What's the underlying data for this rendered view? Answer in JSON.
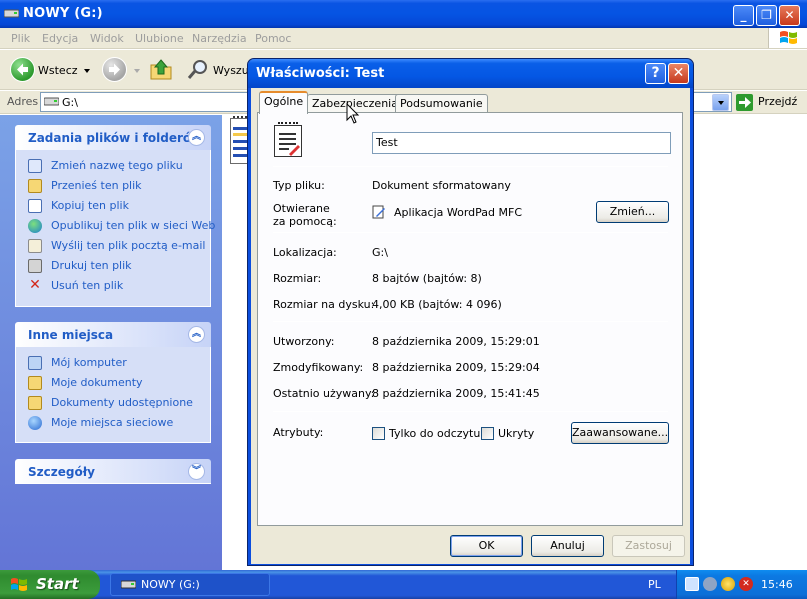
{
  "explorer": {
    "title": "NOWY (G:)",
    "menu": [
      "Plik",
      "Edycja",
      "Widok",
      "Ulubione",
      "Narzędzia",
      "Pomoc"
    ],
    "toolbar": {
      "back_label": "Wstecz",
      "search_label": "Wyszuk"
    },
    "address": {
      "label": "Adres",
      "value": "G:\\",
      "go_label": "Przejdź"
    },
    "tasks_panel": {
      "title": "Zadania plików i folderów",
      "items": [
        {
          "label": "Zmień nazwę tego pliku",
          "icon": "rename-icon"
        },
        {
          "label": "Przenieś ten plik",
          "icon": "move-icon"
        },
        {
          "label": "Kopiuj ten plik",
          "icon": "copy-icon"
        },
        {
          "label": "Opublikuj ten plik w sieci Web",
          "icon": "globe-icon"
        },
        {
          "label": "Wyślij ten plik pocztą e-mail",
          "icon": "email-icon"
        },
        {
          "label": "Drukuj ten plik",
          "icon": "printer-icon"
        },
        {
          "label": "Usuń ten plik",
          "icon": "delete-icon"
        }
      ]
    },
    "places_panel": {
      "title": "Inne miejsca",
      "items": [
        {
          "label": "Mój komputer",
          "icon": "computer-icon"
        },
        {
          "label": "Moje dokumenty",
          "icon": "folder-icon"
        },
        {
          "label": "Dokumenty udostępnione",
          "icon": "folder-icon"
        },
        {
          "label": "Moje miejsca sieciowe",
          "icon": "network-icon"
        }
      ]
    },
    "details_panel": {
      "title": "Szczegóły"
    }
  },
  "dialog": {
    "title": "Właściwości: Test",
    "tabs": [
      "Ogólne",
      "Zabezpieczenia",
      "Podsumowanie"
    ],
    "file_name": "Test",
    "rows": {
      "type_label": "Typ pliku:",
      "type_value": "Dokument sformatowany",
      "opens_label_1": "Otwierane",
      "opens_label_2": "za pomocą:",
      "opens_value": "Aplikacja WordPad MFC",
      "change_button": "Zmień...",
      "location_label": "Lokalizacja:",
      "location_value": "G:\\",
      "size_label": "Rozmiar:",
      "size_value": "8 bajtów (bajtów: 8)",
      "disk_size_label": "Rozmiar na dysku:",
      "disk_size_value": "4,00 KB (bajtów: 4 096)",
      "created_label": "Utworzony:",
      "created_value": "8 października 2009, 15:29:01",
      "modified_label": "Zmodyfikowany:",
      "modified_value": "8 października 2009, 15:29:04",
      "accessed_label": "Ostatnio używany:",
      "accessed_value": "8 października 2009, 15:41:45",
      "attributes_label": "Atrybuty:",
      "readonly_label": "Tylko do odczytu",
      "hidden_label": "Ukryty",
      "advanced_button": "Zaawansowane..."
    },
    "buttons": {
      "ok": "OK",
      "cancel": "Anuluj",
      "apply": "Zastosuj"
    }
  },
  "taskbar": {
    "start_label": "Start",
    "window_button": "NOWY (G:)",
    "language": "PL",
    "clock": "15:46"
  },
  "colors": {
    "xp_blue": "#0554e3",
    "link_blue": "#215dc6",
    "start_green": "#2f8b2f",
    "tab_highlight": "#e68b2c"
  }
}
